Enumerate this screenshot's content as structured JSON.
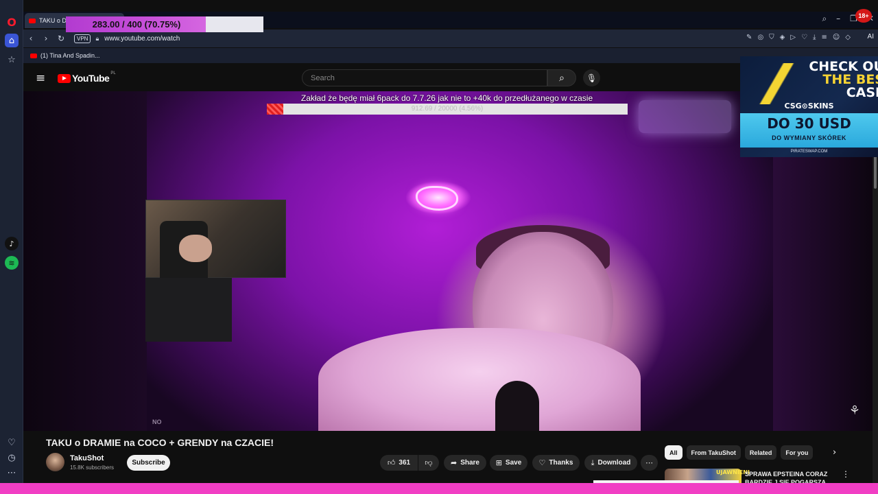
{
  "browser": {
    "tab_title": "TAKU o DRA",
    "url": "www.youtube.com/watch",
    "vpn_label": "VPN",
    "bookmark": "(1) Tina And Spadin...",
    "ai_label": "AI"
  },
  "overlay_progress": {
    "text": "283.00 / 400 (70.75%)",
    "fraction": 0.7075
  },
  "goal": {
    "title": "Zakład że będę miał 6pack do 7.7.26 jak nie to +40k do przedłużanego w czasie",
    "text": "912.69 / 20000 (4.56%)",
    "fraction": 0.0456
  },
  "youtube": {
    "logo_text": "YouTube",
    "country": "PL",
    "search_placeholder": "Search"
  },
  "video": {
    "title": "TAKU o DRAMIE na COCO + GRENDY na CZACIE!",
    "watermark": "NO",
    "channel_name": "TakuShot",
    "subscribers": "15.8K subscribers",
    "subscribe_label": "Subscribe",
    "like_count": "361",
    "share_label": "Share",
    "save_label": "Save",
    "thanks_label": "Thanks",
    "download_label": "Download"
  },
  "chips": [
    "All",
    "From TakuShot",
    "Related",
    "For you"
  ],
  "related": {
    "thumb_text": "UJAWNIENI",
    "title": "SPRAWA EPSTEINA CORAZ BARDZIE J SIE POGARSZA"
  },
  "ad": {
    "headline_1": "CHECK OU",
    "headline_2": "THE BES",
    "headline_3": "CASE",
    "brand": "CSG⊙SKINS",
    "offer": "DO 30 USD",
    "offer_sub": "DO WYMIANY SKÓREK",
    "url": "PIRATESWAP.COM",
    "age_badge": "18+"
  },
  "colors": {
    "youtube_red": "#ff0000",
    "opera_red": "#ff1b2d",
    "stream_purple": "#9b19c8",
    "accent_pink": "#f13ec4"
  }
}
